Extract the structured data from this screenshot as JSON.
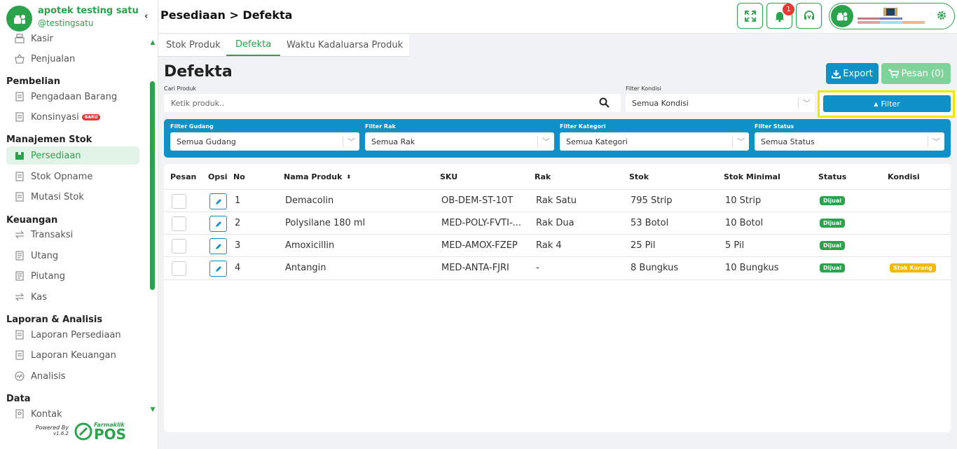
{
  "brand": {
    "name": "apotek testing satu",
    "handle": "@testingsatu"
  },
  "sidebar": {
    "items": [
      {
        "label": "Kasir",
        "icon": "cashier-icon"
      },
      {
        "label": "Penjualan",
        "icon": "basket-icon"
      }
    ],
    "sections": [
      {
        "title": "Pembelian",
        "items": [
          {
            "label": "Pengadaan Barang",
            "icon": "receipt-icon"
          },
          {
            "label": "Konsinyasi",
            "icon": "receipt-icon",
            "badge": "BARU"
          }
        ]
      },
      {
        "title": "Manajemen Stok",
        "items": [
          {
            "label": "Persediaan",
            "icon": "box-icon",
            "active": true
          },
          {
            "label": "Stok Opname",
            "icon": "receipt-icon"
          },
          {
            "label": "Mutasi Stok",
            "icon": "receipt-icon"
          }
        ]
      },
      {
        "title": "Keuangan",
        "items": [
          {
            "label": "Transaksi",
            "icon": "transfer-icon"
          },
          {
            "label": "Utang",
            "icon": "document-icon"
          },
          {
            "label": "Piutang",
            "icon": "document-icon"
          },
          {
            "label": "Kas",
            "icon": "transfer-icon"
          }
        ]
      },
      {
        "title": "Laporan & Analisis",
        "items": [
          {
            "label": "Laporan Persediaan",
            "icon": "receipt-icon"
          },
          {
            "label": "Laporan Keuangan",
            "icon": "receipt-icon"
          },
          {
            "label": "Analisis",
            "icon": "chart-icon"
          }
        ]
      },
      {
        "title": "Data",
        "items": [
          {
            "label": "Kontak",
            "icon": "contact-icon"
          }
        ]
      }
    ],
    "powered_by": "Powered By",
    "version": "v1.6.2",
    "footer_brand_top": "Farmaklik",
    "footer_brand_bottom": "POS"
  },
  "header": {
    "breadcrumb": "Pesediaan > Defekta",
    "notif_count": "1"
  },
  "tabs": [
    {
      "label": "Stok Produk"
    },
    {
      "label": "Defekta",
      "active": true
    },
    {
      "label": "Waktu Kadaluarsa Produk"
    }
  ],
  "page": {
    "title": "Defekta",
    "export_label": "Export",
    "pesan_label": "Pesan (0)",
    "search_label": "Cari Produk",
    "search_placeholder": "Ketik produk..",
    "kondisi_label": "Filter Kondisi",
    "kondisi_value": "Semua Kondisi",
    "filter_label": "Filter"
  },
  "filters": [
    {
      "label": "Filter Gudang",
      "value": "Semua Gudang"
    },
    {
      "label": "Filter Rak",
      "value": "Semua Rak"
    },
    {
      "label": "Filter Kategori",
      "value": "Semua Kategori"
    },
    {
      "label": "Filter Status",
      "value": "Semua Status"
    }
  ],
  "table": {
    "headers": [
      "Pesan",
      "Opsi",
      "No",
      "Nama Produk",
      "SKU",
      "Rak",
      "Stok",
      "Stok Minimal",
      "Status",
      "Kondisi"
    ],
    "rows": [
      {
        "no": "1",
        "name": "Demacolin",
        "sku": "OB-DEM-ST-10T",
        "rak": "Rak Satu",
        "stok": "795 Strip",
        "min": "10 Strip",
        "status": "Dijual",
        "kondisi": ""
      },
      {
        "no": "2",
        "name": "Polysilane 180 ml",
        "sku": "MED-POLY-FVTI-...",
        "rak": "Rak Dua",
        "stok": "53 Botol",
        "min": "10 Botol",
        "status": "Dijual",
        "kondisi": ""
      },
      {
        "no": "3",
        "name": "Amoxicillin",
        "sku": "MED-AMOX-FZEP",
        "rak": "Rak 4",
        "stok": "25 Pil",
        "min": "5 Pil",
        "status": "Dijual",
        "kondisi": ""
      },
      {
        "no": "4",
        "name": "Antangin",
        "sku": "MED-ANTA-FJRI",
        "rak": "-",
        "stok": "8 Bungkus",
        "min": "10 Bungkus",
        "status": "Dijual",
        "kondisi": "Stok Kurang"
      }
    ]
  },
  "colors": {
    "brand_green": "#2ba24c",
    "primary_blue": "#0f90c7",
    "highlight": "#f3e600",
    "warning": "#f5b800"
  }
}
